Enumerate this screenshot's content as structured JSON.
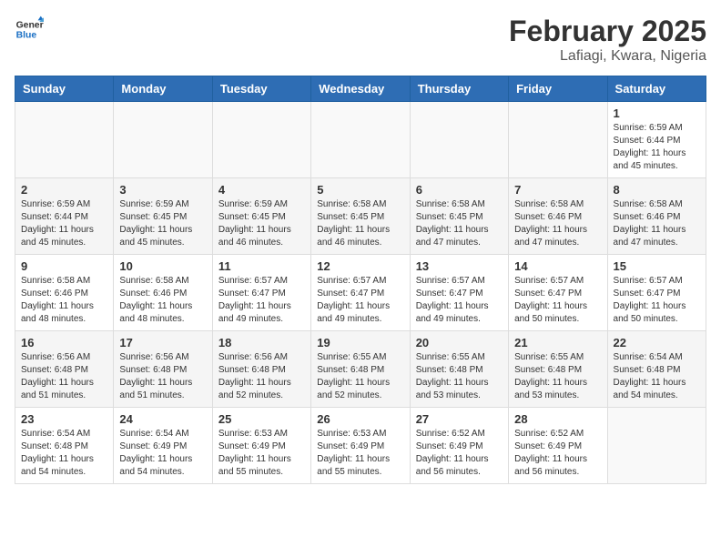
{
  "logo": {
    "line1": "General",
    "line2": "Blue"
  },
  "title": "February 2025",
  "location": "Lafiagi, Kwara, Nigeria",
  "weekdays": [
    "Sunday",
    "Monday",
    "Tuesday",
    "Wednesday",
    "Thursday",
    "Friday",
    "Saturday"
  ],
  "weeks": [
    [
      {
        "day": "",
        "info": ""
      },
      {
        "day": "",
        "info": ""
      },
      {
        "day": "",
        "info": ""
      },
      {
        "day": "",
        "info": ""
      },
      {
        "day": "",
        "info": ""
      },
      {
        "day": "",
        "info": ""
      },
      {
        "day": "1",
        "info": "Sunrise: 6:59 AM\nSunset: 6:44 PM\nDaylight: 11 hours\nand 45 minutes."
      }
    ],
    [
      {
        "day": "2",
        "info": "Sunrise: 6:59 AM\nSunset: 6:44 PM\nDaylight: 11 hours\nand 45 minutes."
      },
      {
        "day": "3",
        "info": "Sunrise: 6:59 AM\nSunset: 6:45 PM\nDaylight: 11 hours\nand 45 minutes."
      },
      {
        "day": "4",
        "info": "Sunrise: 6:59 AM\nSunset: 6:45 PM\nDaylight: 11 hours\nand 46 minutes."
      },
      {
        "day": "5",
        "info": "Sunrise: 6:58 AM\nSunset: 6:45 PM\nDaylight: 11 hours\nand 46 minutes."
      },
      {
        "day": "6",
        "info": "Sunrise: 6:58 AM\nSunset: 6:45 PM\nDaylight: 11 hours\nand 47 minutes."
      },
      {
        "day": "7",
        "info": "Sunrise: 6:58 AM\nSunset: 6:46 PM\nDaylight: 11 hours\nand 47 minutes."
      },
      {
        "day": "8",
        "info": "Sunrise: 6:58 AM\nSunset: 6:46 PM\nDaylight: 11 hours\nand 47 minutes."
      }
    ],
    [
      {
        "day": "9",
        "info": "Sunrise: 6:58 AM\nSunset: 6:46 PM\nDaylight: 11 hours\nand 48 minutes."
      },
      {
        "day": "10",
        "info": "Sunrise: 6:58 AM\nSunset: 6:46 PM\nDaylight: 11 hours\nand 48 minutes."
      },
      {
        "day": "11",
        "info": "Sunrise: 6:57 AM\nSunset: 6:47 PM\nDaylight: 11 hours\nand 49 minutes."
      },
      {
        "day": "12",
        "info": "Sunrise: 6:57 AM\nSunset: 6:47 PM\nDaylight: 11 hours\nand 49 minutes."
      },
      {
        "day": "13",
        "info": "Sunrise: 6:57 AM\nSunset: 6:47 PM\nDaylight: 11 hours\nand 49 minutes."
      },
      {
        "day": "14",
        "info": "Sunrise: 6:57 AM\nSunset: 6:47 PM\nDaylight: 11 hours\nand 50 minutes."
      },
      {
        "day": "15",
        "info": "Sunrise: 6:57 AM\nSunset: 6:47 PM\nDaylight: 11 hours\nand 50 minutes."
      }
    ],
    [
      {
        "day": "16",
        "info": "Sunrise: 6:56 AM\nSunset: 6:48 PM\nDaylight: 11 hours\nand 51 minutes."
      },
      {
        "day": "17",
        "info": "Sunrise: 6:56 AM\nSunset: 6:48 PM\nDaylight: 11 hours\nand 51 minutes."
      },
      {
        "day": "18",
        "info": "Sunrise: 6:56 AM\nSunset: 6:48 PM\nDaylight: 11 hours\nand 52 minutes."
      },
      {
        "day": "19",
        "info": "Sunrise: 6:55 AM\nSunset: 6:48 PM\nDaylight: 11 hours\nand 52 minutes."
      },
      {
        "day": "20",
        "info": "Sunrise: 6:55 AM\nSunset: 6:48 PM\nDaylight: 11 hours\nand 53 minutes."
      },
      {
        "day": "21",
        "info": "Sunrise: 6:55 AM\nSunset: 6:48 PM\nDaylight: 11 hours\nand 53 minutes."
      },
      {
        "day": "22",
        "info": "Sunrise: 6:54 AM\nSunset: 6:48 PM\nDaylight: 11 hours\nand 54 minutes."
      }
    ],
    [
      {
        "day": "23",
        "info": "Sunrise: 6:54 AM\nSunset: 6:48 PM\nDaylight: 11 hours\nand 54 minutes."
      },
      {
        "day": "24",
        "info": "Sunrise: 6:54 AM\nSunset: 6:49 PM\nDaylight: 11 hours\nand 54 minutes."
      },
      {
        "day": "25",
        "info": "Sunrise: 6:53 AM\nSunset: 6:49 PM\nDaylight: 11 hours\nand 55 minutes."
      },
      {
        "day": "26",
        "info": "Sunrise: 6:53 AM\nSunset: 6:49 PM\nDaylight: 11 hours\nand 55 minutes."
      },
      {
        "day": "27",
        "info": "Sunrise: 6:52 AM\nSunset: 6:49 PM\nDaylight: 11 hours\nand 56 minutes."
      },
      {
        "day": "28",
        "info": "Sunrise: 6:52 AM\nSunset: 6:49 PM\nDaylight: 11 hours\nand 56 minutes."
      },
      {
        "day": "",
        "info": ""
      }
    ]
  ]
}
